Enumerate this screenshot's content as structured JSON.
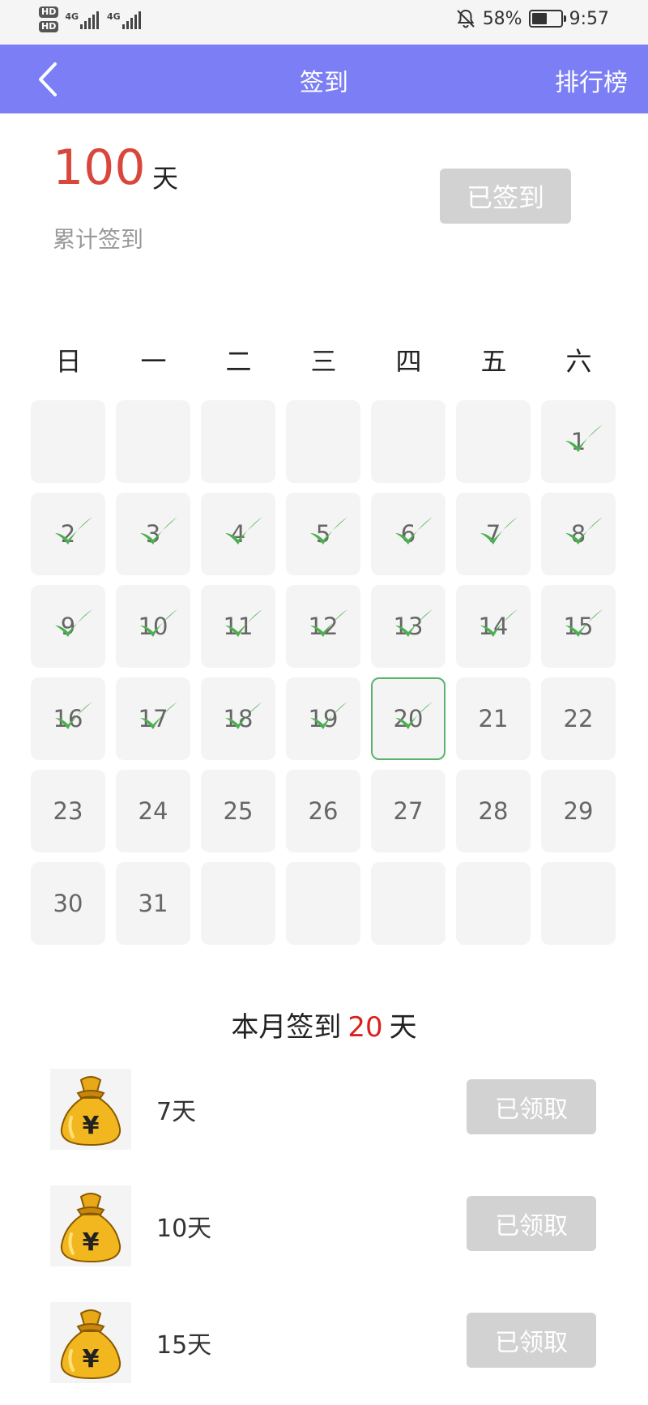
{
  "status_bar": {
    "sim1": "HD",
    "sim2": "HD",
    "net1": "4G",
    "net2": "4G",
    "battery_text": "58%",
    "battery_level": 0.58,
    "time": "9:57",
    "icons": [
      "hd-icon",
      "signal-icon",
      "mute-bell-icon",
      "battery-icon"
    ]
  },
  "nav": {
    "back_icon": "chevron-left-icon",
    "title": "签到",
    "rank_label": "排行榜",
    "color": "#7b7ef5"
  },
  "summary": {
    "total_days": "100",
    "total_unit": "天",
    "total_label": "累计签到",
    "checkin_button": "已签到"
  },
  "calendar": {
    "weekdays": [
      "日",
      "一",
      "二",
      "三",
      "四",
      "五",
      "六"
    ],
    "leading_blanks": 6,
    "days_in_month": 31,
    "checked_through": 20,
    "today": 20,
    "check_color": "#4caf50",
    "today_border_color": "#5ab36a"
  },
  "month": {
    "prefix": "本月签到",
    "count": "20",
    "suffix": "天"
  },
  "rewards": [
    {
      "label": "7天",
      "button": "已领取",
      "icon": "money-bag-icon"
    },
    {
      "label": "10天",
      "button": "已领取",
      "icon": "money-bag-icon"
    },
    {
      "label": "15天",
      "button": "已领取",
      "icon": "money-bag-icon"
    }
  ]
}
